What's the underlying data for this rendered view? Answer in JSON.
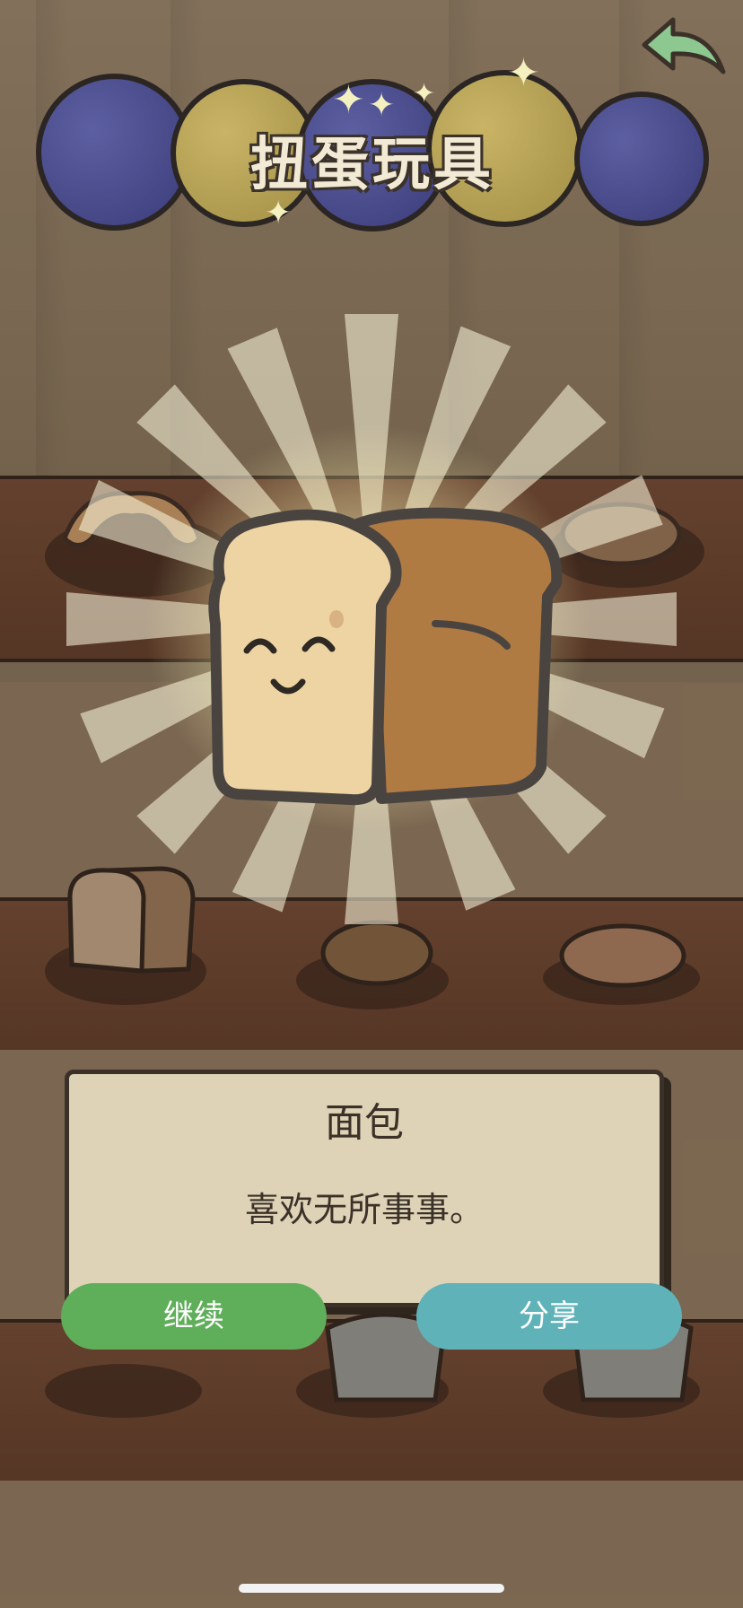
{
  "header": {
    "title": "扭蛋玩具",
    "back_icon": "curved-back-arrow-icon"
  },
  "item": {
    "name": "面包",
    "description": "喜欢无所事事。",
    "icon": "bread-loaf-icon"
  },
  "actions": {
    "continue_label": "继续",
    "share_label": "分享"
  },
  "colors": {
    "continue_button": "#5fae5a",
    "share_button": "#5fb2b8",
    "dialog_bg": "#ded3b6",
    "ball_blue": "#4a4c8c",
    "ball_yellow": "#b8a455"
  }
}
